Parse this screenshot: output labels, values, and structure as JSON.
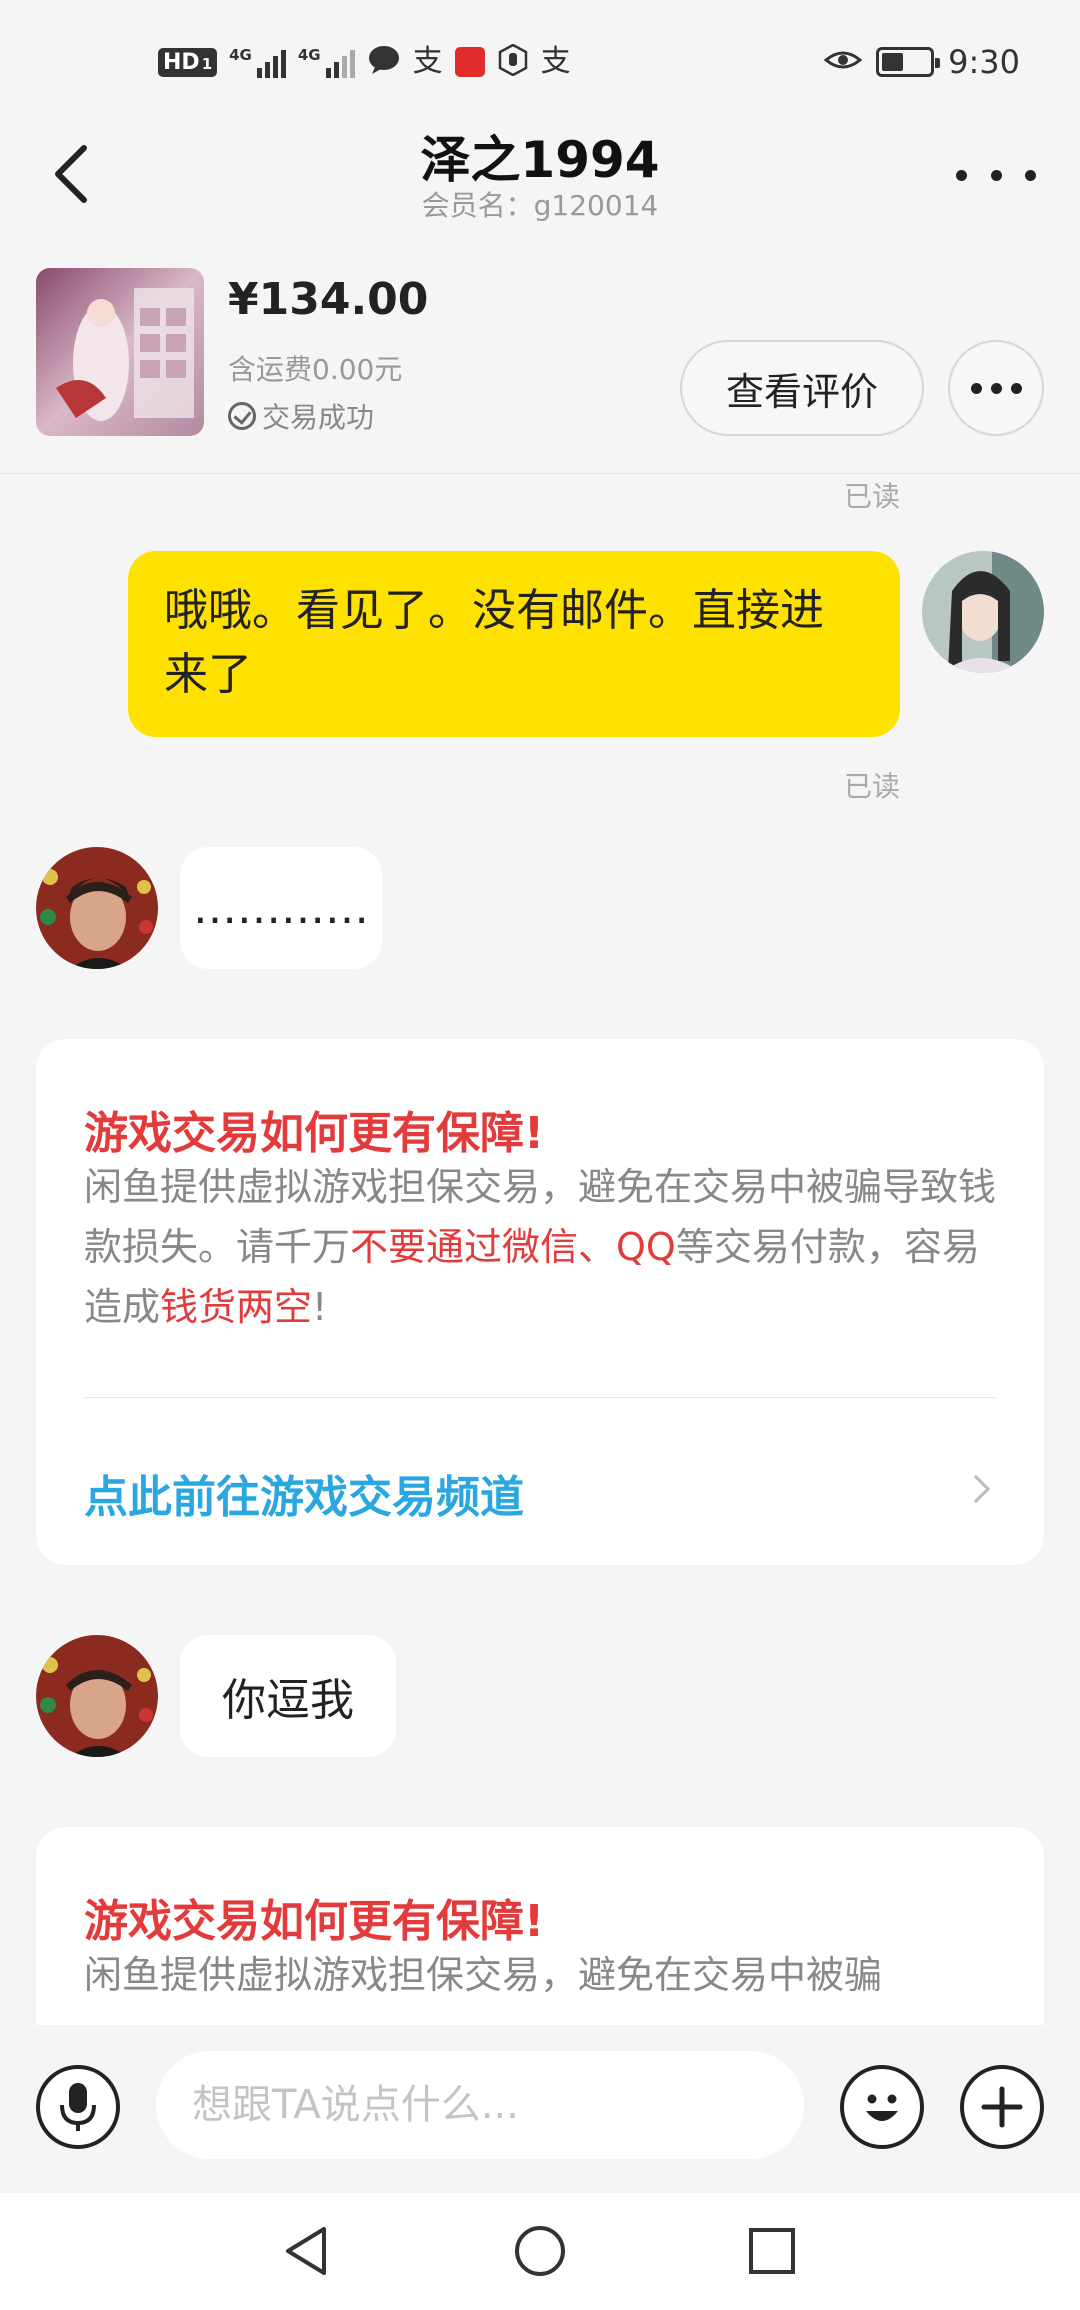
{
  "status_bar": {
    "network_badge": "HD",
    "network_badge_sub": "1",
    "signal1_label": "4G",
    "signal2_label": "4G",
    "app_icons": [
      "chat-bubble-icon",
      "alipay-icon",
      "red-app-icon",
      "hand-icon",
      "alipay-icon"
    ],
    "time": "9:30",
    "battery_level": 0.45
  },
  "header": {
    "title": "泽之1994",
    "subtitle": "会员名：g120014"
  },
  "product": {
    "price": "¥134.00",
    "shipping": "含运费0.00元",
    "status": "交易成功",
    "review_button": "查看评价"
  },
  "chat": {
    "read_top": "已读",
    "my_message": "哦哦。看见了。没有邮件。直接进来了",
    "read_after_message": "已读",
    "other_message_1": "…………",
    "notice_1": {
      "title": "游戏交易如何更有保障!",
      "body_part1": "闲鱼提供虚拟游戏担保交易，避免在交易中被骗导致钱款损失。请千万",
      "body_red1": "不要通过微信、QQ",
      "body_part2": "等交易付款，容易造成",
      "body_red2": "钱货两空",
      "body_part3": "!",
      "link": "点此前往游戏交易频道"
    },
    "other_message_2": "你逗我",
    "notice_2": {
      "title": "游戏交易如何更有保障!",
      "body_part1": "闲鱼提供虚拟游戏担保交易，避免在交易中被骗"
    }
  },
  "input_bar": {
    "placeholder": "想跟TA说点什么..."
  },
  "colors": {
    "my_bubble": "#ffe100",
    "warning_red": "#e33b3b",
    "link_blue": "#2aa7e0",
    "background": "#f5f5f5"
  }
}
